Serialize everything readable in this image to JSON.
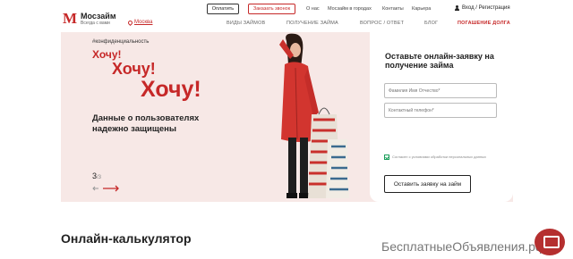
{
  "header": {
    "logo_mark": "М",
    "logo_name": "Мосзайм",
    "logo_tagline": "Всегда с вами",
    "city": "Москва",
    "pay_button": "Оплатить",
    "call_button": "Заказать звонок",
    "top_links": [
      "О нас",
      "Мосзайм в городах",
      "Контакты",
      "Карьера"
    ],
    "login": "Вход / Регистрация",
    "nav": [
      "ВИДЫ ЗАЙМОВ",
      "ПОЛУЧЕНИЕ ЗАЙМА",
      "ВОПРОС / ОТВЕТ",
      "БЛОГ",
      "ПОГАШЕНИЕ ДОЛГА"
    ]
  },
  "hero": {
    "tag": "#конфиденциальность",
    "line1": "Хочу!",
    "line2": "Хочу!",
    "line3": "Хочу!",
    "description": "Данные о пользователях надежно защищены",
    "slide_current": "3",
    "slide_total": "/3"
  },
  "form": {
    "title": "Оставьте онлайн-заявку на получение займа",
    "name_placeholder": "Фамилия Имя Отчество*",
    "phone_placeholder": "Контактный телефон*",
    "consent": "Согласен с условиями обработки персональных данных",
    "submit": "Оставить заявку на займ"
  },
  "calculator_title": "Онлайн-калькулятор",
  "watermark": "БесплатныеОбъявления.рф",
  "colors": {
    "brand": "#c62828",
    "hero_bg": "#f7e8e6",
    "check": "#1a9e5a"
  }
}
